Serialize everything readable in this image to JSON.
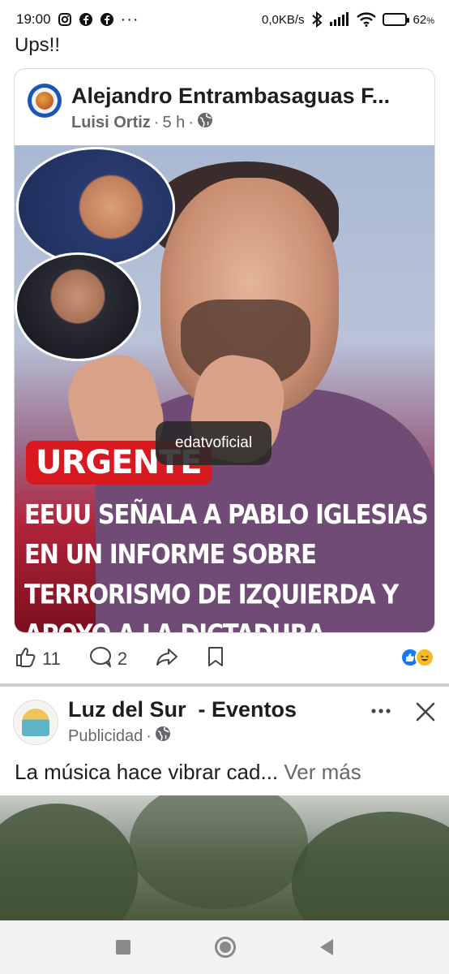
{
  "status_bar": {
    "time": "19:00",
    "network_speed": "0,0KB/s",
    "battery_percent": "62",
    "battery_unit": "%",
    "left_icons": [
      "instagram-icon",
      "facebook-icon",
      "facebook-icon",
      "more-dots-icon"
    ],
    "right_icons": [
      "bluetooth-icon",
      "signal-icon",
      "wifi-icon",
      "battery-icon"
    ],
    "battery_level": 0.62
  },
  "prior_post": {
    "text": "Ups!!"
  },
  "shared_post": {
    "group_name": "Alejandro Entrambasaguas F...",
    "author": "Luisi Ortiz",
    "time": "5 h",
    "separator": "·",
    "privacy_icon": "globe-icon",
    "image": {
      "badge": "URGENTE",
      "headline_lines": [
        "EEUU SEÑALA A PABLO IGLESIAS",
        "EN UN INFORME SOBRE",
        "TERRORISMO DE IZQUIERDA Y",
        "APOYO A LA DICTADURA CUBANA"
      ],
      "watermark": "edatvoficial"
    },
    "actions": {
      "likes": "11",
      "comments": "2",
      "reactions": [
        "like-reaction-icon",
        "haha-reaction-icon"
      ]
    }
  },
  "ad_post": {
    "page_name": "Luz del Sur  - Eventos",
    "sponsored_label": "Publicidad",
    "separator": "·",
    "privacy_icon": "globe-icon",
    "caption": "La música hace vibrar cad...",
    "see_more": "Ver más"
  },
  "nav_bar": {
    "icons": [
      "recents-square-icon",
      "home-circle-icon",
      "back-triangle-icon"
    ]
  }
}
